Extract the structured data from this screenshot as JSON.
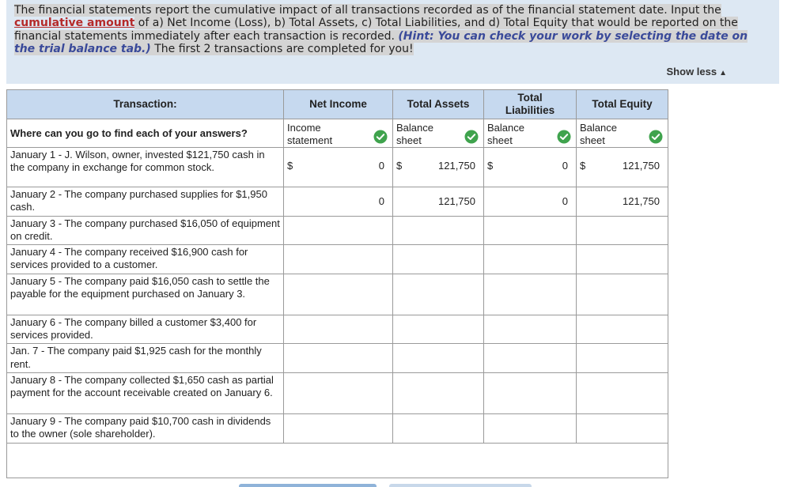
{
  "instructions": {
    "part1": "The financial statements report the cumulative impact of all transactions recorded as of the financial statement date. Input the ",
    "cumulative": "cumulative amount",
    "part2": " of a) Net Income (Loss), b) Total Assets, c) Total Liabilities, and d) Total Equity that would be reported on the financial statements immediately after each transaction is recorded. ",
    "hint": "(Hint: You can check your work by selecting the date on the trial balance tab.)",
    "part3": " The first 2 transactions are completed for you!"
  },
  "show_less": "Show less",
  "columns": {
    "transaction": "Transaction:",
    "net_income": "Net Income",
    "total_assets": "Total Assets",
    "total_liabilities": "Total Liabilities",
    "total_equity": "Total Equity"
  },
  "question_row": {
    "label": "Where can you go to find each of your answers?",
    "net_income": "Income statement",
    "total_assets": "Balance sheet",
    "total_liabilities": "Balance sheet",
    "total_equity": "Balance sheet"
  },
  "rows": [
    {
      "label": "January 1 - J. Wilson, owner, invested $121,750 cash in the company in exchange for common stock.",
      "net_income": "0",
      "total_assets": "121,750",
      "total_liabilities": "0",
      "total_equity": "121,750"
    },
    {
      "label": "January 2 - The company purchased supplies for $1,950 cash.",
      "net_income": "0",
      "total_assets": "121,750",
      "total_liabilities": "0",
      "total_equity": "121,750"
    },
    {
      "label": "January 3 - The company purchased $16,050 of equipment on credit."
    },
    {
      "label": "January 4 - The company received $16,900 cash for services provided to a customer."
    },
    {
      "label": "January 5 - The company paid $16,050 cash to settle the payable for the equipment purchased on January 3."
    },
    {
      "label": "January 6 - The company billed a customer $3,400 for services provided."
    },
    {
      "label": "Jan. 7 - The company paid $1,925 cash for the monthly rent."
    },
    {
      "label": "January 8 - The company collected $1,650 cash as partial payment for the account receivable created on January 6."
    },
    {
      "label": "January 9 - The company paid $10,700 cash in dividends to the owner (sole shareholder)."
    }
  ],
  "currency_symbol": "$",
  "check_icon": "check-circle-icon",
  "colors": {
    "header_bg": "#c6d9ef",
    "instr_bg": "#dde8f3",
    "check": "#3fa34d",
    "accent_red": "#b52a2a",
    "hint_blue": "#3a4a9a"
  }
}
